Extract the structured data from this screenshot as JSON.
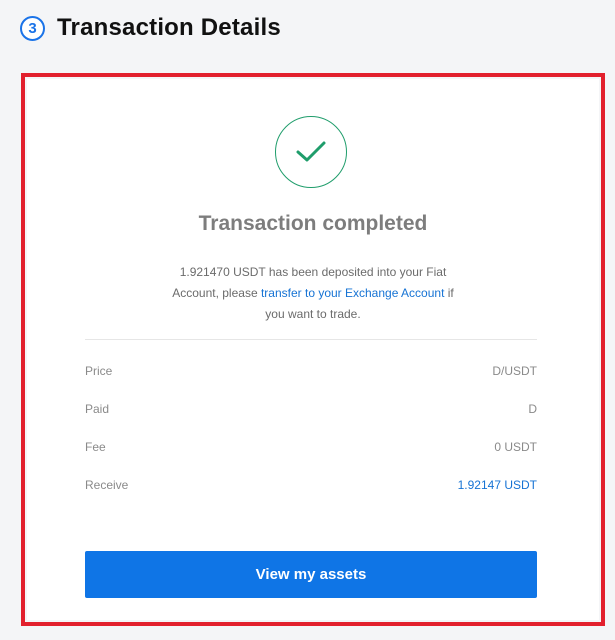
{
  "header": {
    "step_number": "3",
    "title": "Transaction Details"
  },
  "card": {
    "status_icon": "checkmark-icon",
    "status_title": "Transaction completed",
    "message_prefix": "1.921470 USDT has been deposited into your Fiat Account, please ",
    "message_link": "transfer to your Exchange Account",
    "message_suffix": " if you want to trade.",
    "details": [
      {
        "label": "Price",
        "value": "D/USDT"
      },
      {
        "label": "Paid",
        "value": "D"
      },
      {
        "label": "Fee",
        "value": "0 USDT"
      },
      {
        "label": "Receive",
        "value": "1.92147 USDT"
      }
    ],
    "button_label": "View my assets"
  },
  "colors": {
    "accent": "#1673d4",
    "success": "#1f9d6b",
    "highlight": "#e2202d",
    "button": "#0f75e6"
  }
}
